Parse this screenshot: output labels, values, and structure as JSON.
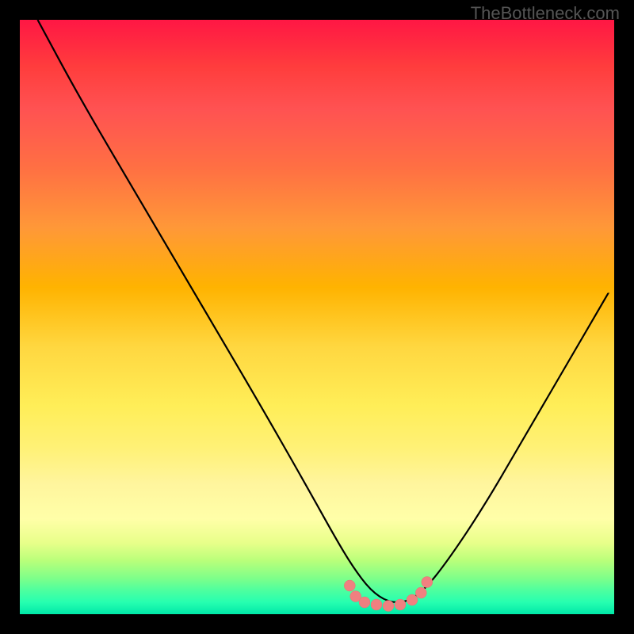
{
  "watermark": "TheBottleneck.com",
  "chart_data": {
    "type": "line",
    "title": "",
    "xlabel": "",
    "ylabel": "",
    "xlim": [
      0,
      100
    ],
    "ylim": [
      0,
      100
    ],
    "grid": false,
    "legend": false,
    "description": "V-shaped curve over vertical red-to-green gradient; minimum near x≈60 touching bottom (green) region; pink marker cluster at the valley bottom.",
    "series": [
      {
        "name": "curve",
        "x": [
          3,
          10,
          20,
          30,
          40,
          48,
          53,
          56,
          59,
          62,
          65,
          68,
          72,
          78,
          85,
          92,
          99
        ],
        "y": [
          100,
          87,
          70,
          53,
          36,
          22,
          13,
          8,
          4,
          2,
          2,
          4,
          9,
          18,
          30,
          42,
          54
        ]
      }
    ],
    "markers": {
      "name": "valley-dots",
      "color": "#f08080",
      "x": [
        55.5,
        56.5,
        58,
        60,
        62,
        64,
        66,
        67.5,
        68.5
      ],
      "y": [
        4.8,
        3.0,
        2.0,
        1.6,
        1.4,
        1.6,
        2.4,
        3.6,
        5.4
      ]
    },
    "gradient_stops": [
      {
        "pos": 0.0,
        "color": "#ff1744"
      },
      {
        "pos": 0.25,
        "color": "#ff7043"
      },
      {
        "pos": 0.5,
        "color": "#ffd740"
      },
      {
        "pos": 0.78,
        "color": "#fff59d"
      },
      {
        "pos": 0.92,
        "color": "#7dff8a"
      },
      {
        "pos": 1.0,
        "color": "#00e8a8"
      }
    ]
  }
}
